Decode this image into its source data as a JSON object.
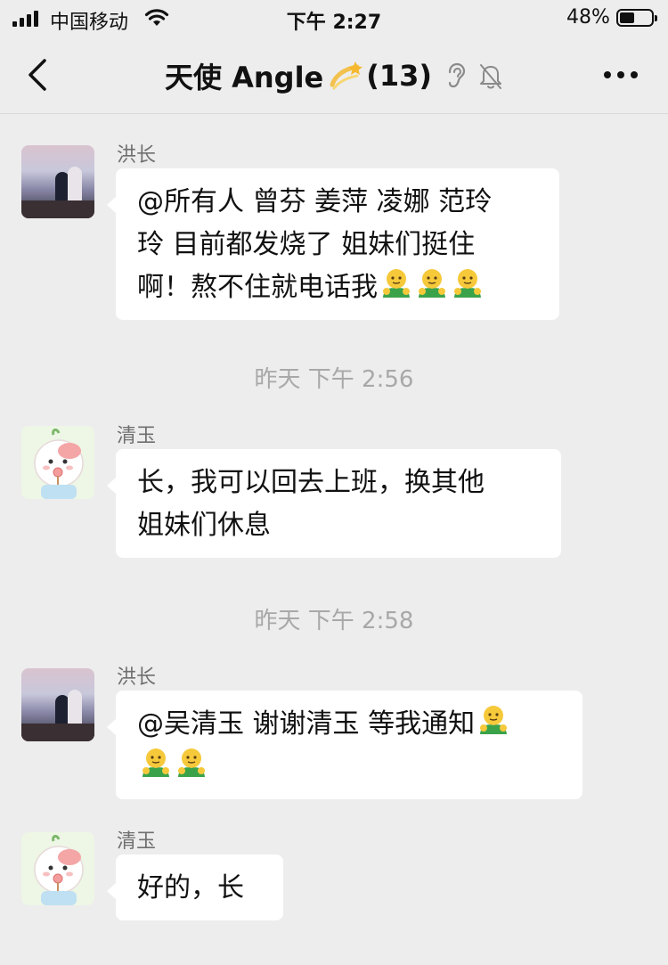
{
  "status_bar": {
    "carrier": "中国移动",
    "time": "下午 2:27",
    "battery_percent": "48%",
    "battery_level": 0.48
  },
  "nav": {
    "title": "天使 Angle",
    "member_count": "(13)",
    "title_emoji": "dizzy-emoji",
    "icons": [
      "back-chevron-icon",
      "ear-icon",
      "mute-bell-icon",
      "more-dots-icon"
    ]
  },
  "messages": [
    {
      "sender": "洪长",
      "avatar": "photo-avatar",
      "text": "@所有人 曾芬 姜萍 凌娜 范玲\n玲 目前都发烧了 姐妹们挺住\n啊！熬不住就电话我",
      "emoji": "hugging-face-emoji ×3"
    },
    {
      "timestamp": "昨天 下午 2:56"
    },
    {
      "sender": "清玉",
      "avatar": "cartoon-avatar",
      "text": "长，我可以回去上班，换其他\n姐妹们休息"
    },
    {
      "timestamp": "昨天 下午 2:58"
    },
    {
      "sender": "洪长",
      "avatar": "photo-avatar",
      "text": "@吴清玉 谢谢清玉 等我通知",
      "emoji": "hugging-face-emoji ×3"
    },
    {
      "sender": "清玉",
      "avatar": "cartoon-avatar",
      "text": "好的，长"
    }
  ],
  "colors": {
    "background": "#ededed",
    "bubble": "#ffffff",
    "sender_name": "#6f6f6f",
    "timestamp": "#a8a8a8"
  }
}
